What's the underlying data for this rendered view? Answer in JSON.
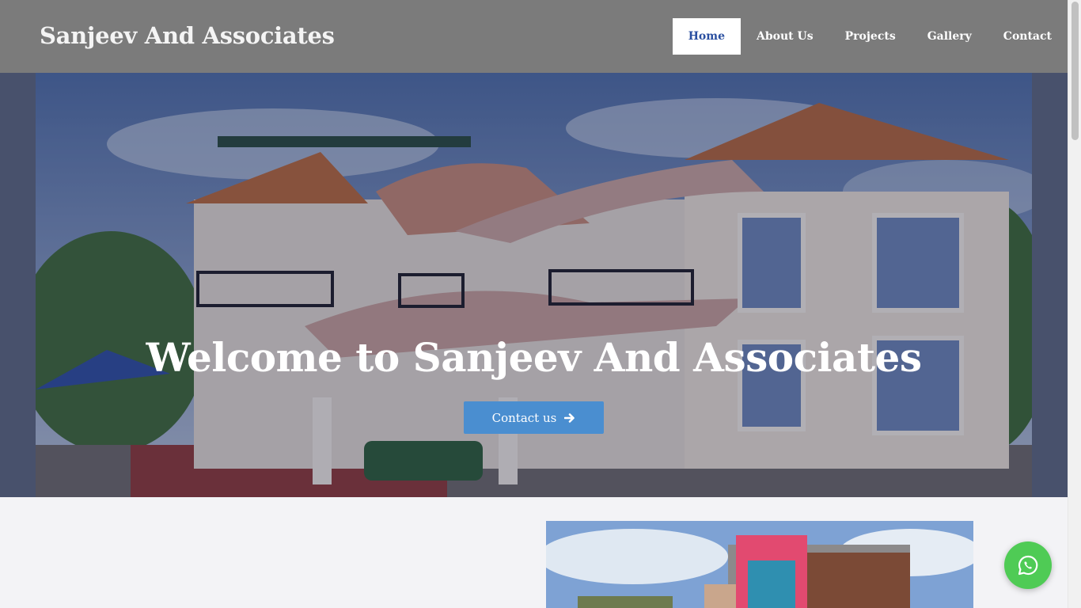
{
  "brand": "Sanjeev And Associates",
  "nav": {
    "home": "Home",
    "about": "About Us",
    "projects": "Projects",
    "gallery": "Gallery",
    "contact": "Contact"
  },
  "hero": {
    "title": "Welcome to Sanjeev And Associates",
    "cta_label": "Contact us"
  },
  "icons": {
    "cta": "arrow-right-icon",
    "float": "whatsapp-icon"
  },
  "colors": {
    "header_bg": "#7b7b7b",
    "nav_active": "#2a4fa0",
    "cta": "#4a8ed0",
    "whatsapp": "#4fcb55"
  }
}
